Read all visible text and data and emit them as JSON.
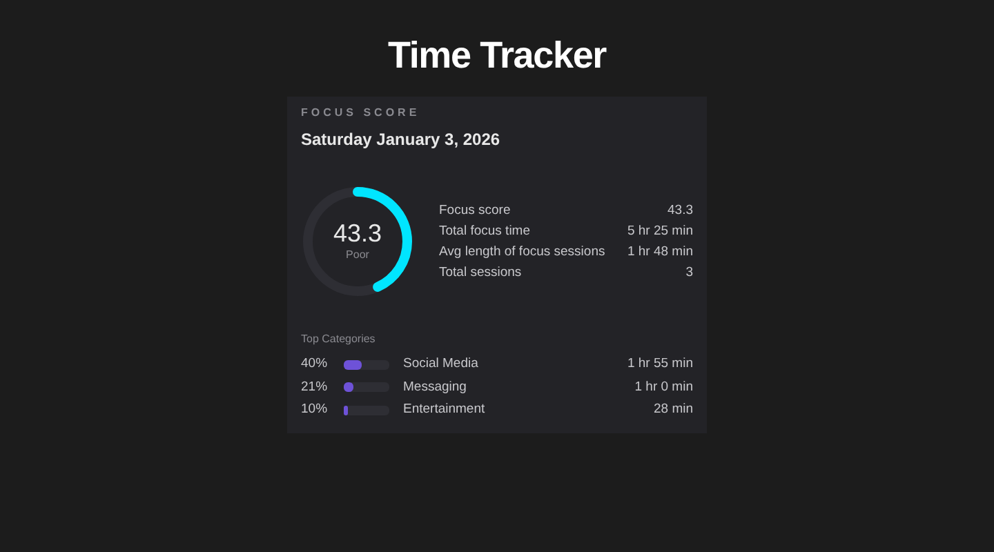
{
  "title": "Time Tracker",
  "card": {
    "eyebrow": "FOCUS SCORE",
    "date": "Saturday January 3, 2026",
    "score": {
      "value": "43.3",
      "rating": "Poor",
      "level": 0.433
    },
    "stats": [
      {
        "label": "Focus score",
        "value": "43.3"
      },
      {
        "label": "Total focus time",
        "value": "5 hr 25 min"
      },
      {
        "label": "Avg length of focus sessions",
        "value": "1 hr 48 min"
      },
      {
        "label": "Total sessions",
        "value": "3"
      }
    ],
    "categories_title": "Top Categories",
    "categories": [
      {
        "percent": "40%",
        "level": 0.4,
        "name": "Social Media",
        "time": "1 hr 55 min"
      },
      {
        "percent": "21%",
        "level": 0.21,
        "name": "Messaging",
        "time": "1 hr 0 min"
      },
      {
        "percent": "10%",
        "level": 0.1,
        "name": "Entertainment",
        "time": "28 min"
      }
    ]
  }
}
